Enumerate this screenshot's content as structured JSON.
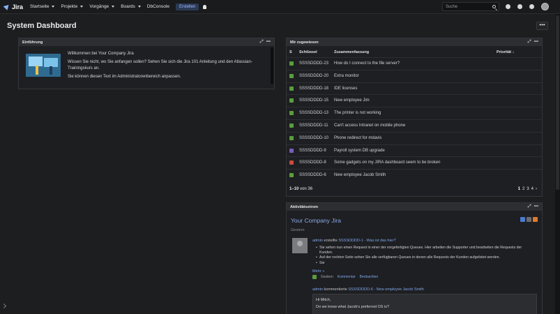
{
  "nav": {
    "logo": "Jira",
    "items": [
      {
        "label": "Startseite"
      },
      {
        "label": "Projekte"
      },
      {
        "label": "Vorgänge"
      },
      {
        "label": "Boards"
      }
    ],
    "dbconsole": "DbConsole",
    "create": "Erstellen",
    "search_placeholder": "Suche"
  },
  "page": {
    "title": "System Dashboard",
    "more": "•••"
  },
  "intro": {
    "title": "Einführung",
    "welcome": "Willkommen bei Your Company Jira",
    "help": "Wissen Sie nicht, wo Sie anfangen sollen? Sehen Sie sich die Jira 101 Anleitung und den Atlassian-Trainingskurs an.",
    "admin_note": "Sie können diesen Text im Administratorenbereich anpassen."
  },
  "assigned": {
    "title": "Mir zugewiesen",
    "columns": {
      "t": "S",
      "key": "Schlüssel",
      "summary": "Zusammenfassung",
      "priority": "Priorität ↓"
    },
    "rows": [
      {
        "key": "SSSSDDDD-23",
        "summary": "How do I connect to the file server?",
        "type_color": "#5b9e3c"
      },
      {
        "key": "SSSSDDDD-20",
        "summary": "Extra monitor",
        "type_color": "#5b9e3c"
      },
      {
        "key": "SSSSDDDD-18",
        "summary": "IDE licenses",
        "type_color": "#5b9e3c"
      },
      {
        "key": "SSSSDDDD-15",
        "summary": "New employee Jim",
        "type_color": "#5b9e3c"
      },
      {
        "key": "SSSSDDDD-13",
        "summary": "The printer is not working",
        "type_color": "#5b9e3c"
      },
      {
        "key": "SSSSDDDD-11",
        "summary": "Can't access Intranet on mobile phone",
        "type_color": "#5b9e3c"
      },
      {
        "key": "SSSSDDDD-10",
        "summary": "Phone redirect for mdavis",
        "type_color": "#5b9e3c"
      },
      {
        "key": "SSSSDDDD-9",
        "summary": "Payroll system DB upgrade",
        "type_color": "#7a5bbd"
      },
      {
        "key": "SSSSDDDD-8",
        "summary": "Some gadgets on my JIRA dashboard seem to be broken",
        "type_color": "#c94c3f"
      },
      {
        "key": "SSSSDDDD-6",
        "summary": "New employee Jacob Smith",
        "type_color": "#5b9e3c"
      }
    ],
    "pager": {
      "count": "1–10",
      "of_label": "von",
      "total": "36",
      "pages": [
        "1",
        "2",
        "3",
        "4"
      ],
      "next": "›"
    }
  },
  "activity": {
    "title": "Aktivitätsstrom",
    "heading": "Your Company Jira",
    "date": "Gestern",
    "entry1": {
      "user": "admin",
      "verb": "erstellte",
      "issue": "SSSSDDDD-1 - Was ist das hier?",
      "bullets": [
        "Sie sehen nun einen Request in einer der vorgefertigten Queues. Hier arbeiten die Supporter und bearbeiten die Requests der Kunden.",
        "Auf der rechten Seite sehen Sie alle verfügbaren Queues in denen alle Requests der Kunden aufgelistet werden.",
        "Sie"
      ],
      "more": "Mehr",
      "more_arrow": "»",
      "footer": {
        "time": "Gestern",
        "comment": "Kommentar",
        "watch": "Beobachten"
      }
    },
    "entry2": {
      "user": "admin",
      "verb": "kommentierte",
      "issue": "SSSSDDDD-6 - New employee Jacob Smith",
      "lines": [
        "Hi Mitch,",
        "Do we know what Jacob's preferred OS is?"
      ]
    }
  }
}
